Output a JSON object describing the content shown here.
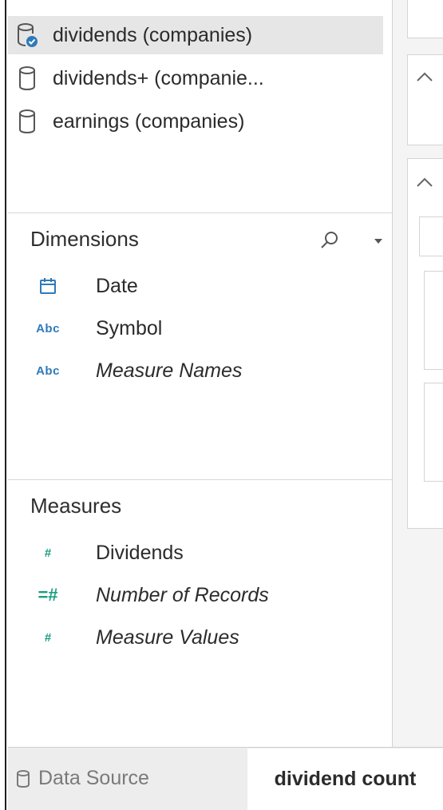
{
  "data_sources": [
    {
      "label": "dividends (companies)",
      "icon": "database-check-icon",
      "selected": true
    },
    {
      "label": "dividends+ (companie...",
      "icon": "database-icon",
      "selected": false
    },
    {
      "label": "earnings (companies)",
      "icon": "database-icon",
      "selected": false
    }
  ],
  "dimensions": {
    "title": "Dimensions",
    "search_icon": "search-icon",
    "menu_icon": "chevron-down-icon",
    "fields": [
      {
        "icon_text": "",
        "icon": "calendar-icon",
        "label": "Date",
        "italic": false
      },
      {
        "icon_text": "Abc",
        "icon": "string-type-icon",
        "label": "Symbol",
        "italic": false
      },
      {
        "icon_text": "Abc",
        "icon": "string-type-icon",
        "label": "Measure Names",
        "italic": true
      }
    ]
  },
  "measures": {
    "title": "Measures",
    "fields": [
      {
        "icon_text": "#",
        "icon": "number-type-icon",
        "label": "Dividends",
        "italic": false
      },
      {
        "icon_text": "=#",
        "icon": "calculated-number-icon",
        "label": "Number of Records",
        "italic": true
      },
      {
        "icon_text": "#",
        "icon": "number-type-icon",
        "label": "Measure Values",
        "italic": true
      }
    ]
  },
  "tabs": {
    "data_source": "Data Source",
    "sheet": "dividend count"
  },
  "colors": {
    "dimension_blue": "#2f7ab8",
    "measure_green": "#1a9d82",
    "selected_bg": "#e6e6e6"
  }
}
